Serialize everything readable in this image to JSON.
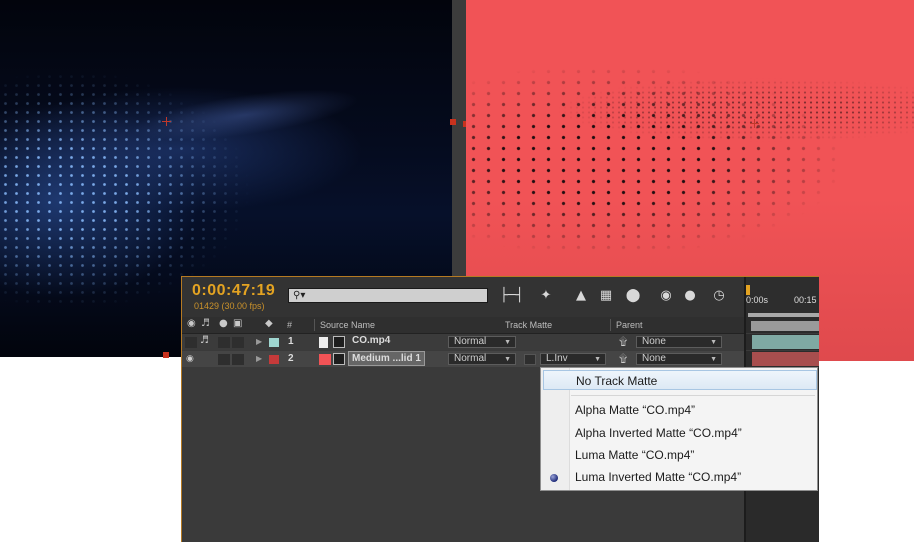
{
  "timeline": {
    "timecode": "0:00:47:19",
    "frame_info": "01429 (30.00 fps)",
    "search": {
      "placeholder": ""
    },
    "ruler": {
      "start": "0:00s",
      "next": "00:15"
    },
    "columns": {
      "number": "#",
      "source_name": "Source Name",
      "track_matte": "Track Matte",
      "parent": "Parent"
    },
    "layers": [
      {
        "number": "1",
        "name": "CO.mp4",
        "label_color": "#9fd6d0",
        "mode": "Normal",
        "track_matte": "",
        "parent": "None",
        "clip_color": "#7fa9a3"
      },
      {
        "number": "2",
        "name": "Medium ...lid 1",
        "label_color": "#c53a3a",
        "mode": "Normal",
        "track_matte": "L.Inv",
        "parent": "None",
        "clip_color": "#a84e4e"
      }
    ]
  },
  "track_matte_menu": {
    "items": [
      {
        "label": "No Track Matte",
        "highlighted": true,
        "selected": false
      },
      {
        "label": "Alpha Matte “CO.mp4”",
        "highlighted": false,
        "selected": false
      },
      {
        "label": "Alpha Inverted Matte “CO.mp4”",
        "highlighted": false,
        "selected": false
      },
      {
        "label": "Luma Matte “CO.mp4”",
        "highlighted": false,
        "selected": false
      },
      {
        "label": "Luma Inverted Matte “CO.mp4”",
        "highlighted": false,
        "selected": true
      }
    ]
  },
  "viewer": {
    "left_preview_colors": [
      "#02040c",
      "#2a4fa0"
    ],
    "right_preview_color": "#f15356"
  },
  "icons": {
    "search": "search-icon",
    "toolbar": [
      "comp-flowchart-icon",
      "draft-3d-icon",
      "shy-layers-icon",
      "frame-blending-icon",
      "motion-blur-icon",
      "graph-editor-icon",
      "brainstorm-icon",
      "stopwatch-icon",
      "preview-render-icon"
    ]
  },
  "accent_color": "#e3a322"
}
